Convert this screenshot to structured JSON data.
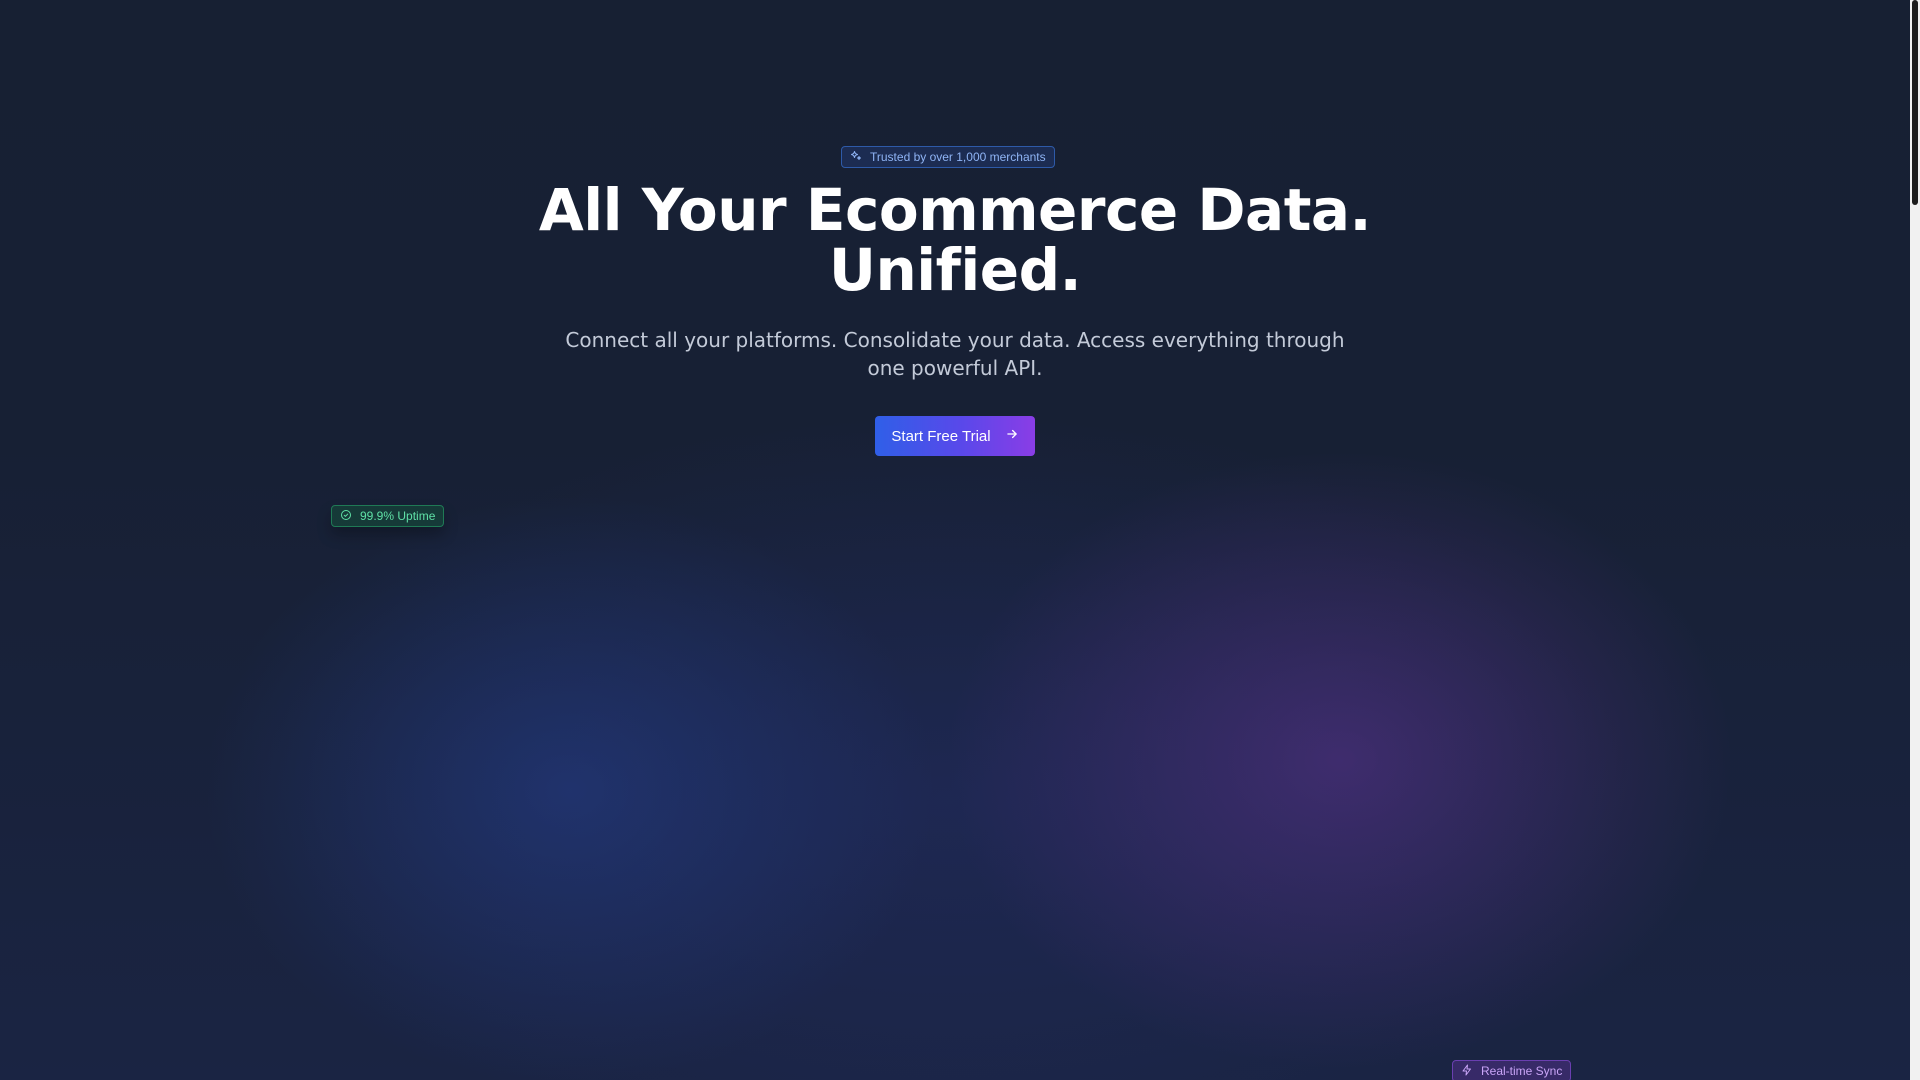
{
  "hero": {
    "badge_text": "Trusted by over 1,000 merchants",
    "badge_icon": "sparkles-icon",
    "headline_line1": "All Your Ecommerce Data.",
    "headline_line2": "Unified.",
    "subheadline": "Connect all your platforms. Consolidate your data. Access everything through one powerful API.",
    "cta_label": "Start Free Trial",
    "cta_icon": "arrow-right-icon"
  },
  "floating_badges": {
    "uptime_label": "99.9% Uptime",
    "uptime_icon": "check-circle-icon",
    "sync_label": "Real-time Sync",
    "sync_icon": "lightning-icon"
  },
  "colors": {
    "background": "#172033",
    "accent_blue": "#2f5fe8",
    "accent_purple": "#8a3de6",
    "uptime_green": "#5fe0a6",
    "sync_purple": "#c9a4f7",
    "badge_blue": "#8fb4f5"
  }
}
